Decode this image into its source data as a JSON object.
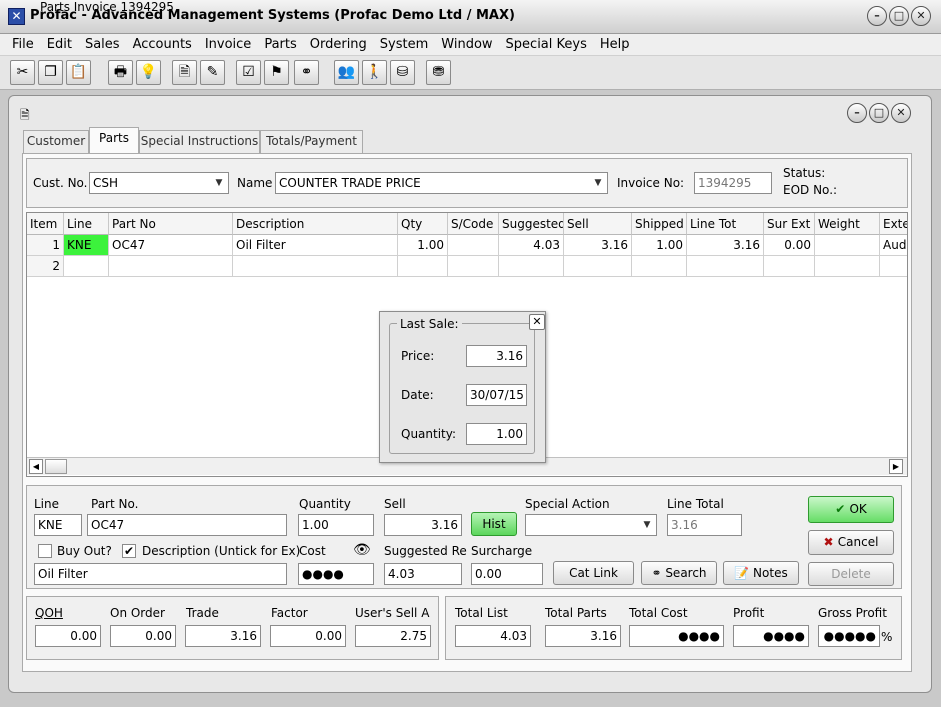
{
  "app_title": "Profac - Advanced Management Systems (Profac Demo Ltd / MAX)",
  "menu": [
    "File",
    "Edit",
    "Sales",
    "Accounts",
    "Invoice",
    "Parts",
    "Ordering",
    "System",
    "Window",
    "Special Keys",
    "Help"
  ],
  "window_title": "Parts Invoice 1394295",
  "tabs": [
    "Customer",
    "Parts",
    "Special Instructions",
    "Totals/Payment"
  ],
  "header": {
    "cust_no_label": "Cust. No.",
    "cust_no": "CSH",
    "name_label": "Name",
    "name": "COUNTER TRADE PRICE",
    "invoice_no_label": "Invoice No:",
    "invoice_no": "1394295",
    "status_label": "Status:",
    "eod_label": "EOD No.:"
  },
  "grid": {
    "columns": [
      "Item",
      "Line",
      "Part No",
      "Description",
      "Qty",
      "S/Code",
      "Suggested",
      "Sell",
      "Shipped",
      "Line Tot",
      "Sur Ext",
      "Weight",
      "Exte"
    ],
    "rows": [
      [
        "1",
        "KNE",
        "OC47",
        "Oil Filter",
        "1.00",
        "",
        "4.03",
        "3.16",
        "1.00",
        "3.16",
        "0.00",
        "",
        "Aud"
      ],
      [
        "2",
        "",
        "",
        "",
        "",
        "",
        "",
        "",
        "",
        "",
        "",
        "",
        ""
      ]
    ]
  },
  "last_sale": {
    "title": "Last Sale:",
    "price_label": "Price:",
    "price": "3.16",
    "date_label": "Date:",
    "date": "30/07/15",
    "quantity_label": "Quantity:",
    "quantity": "1.00"
  },
  "edit": {
    "line_label": "Line",
    "line": "KNE",
    "part_no_label": "Part No.",
    "part_no": "OC47",
    "quantity_label": "Quantity",
    "quantity": "1.00",
    "sell_label": "Sell",
    "sell": "3.16",
    "hist_label": "Hist",
    "special_action_label": "Special Action",
    "line_total_label": "Line Total",
    "line_total": "3.16",
    "buy_out_label": "Buy Out?",
    "description_chk_label": "Description (Untick for Ex)",
    "cost_label": "Cost",
    "cost": "●●●●",
    "suggested_label": "Suggested Re",
    "suggested": "4.03",
    "surcharge_label": "Surcharge",
    "surcharge": "0.00",
    "description": "Oil Filter",
    "cat_link_label": "Cat Link",
    "search_label": "Search",
    "notes_label": "Notes"
  },
  "buttons": {
    "ok": "OK",
    "cancel": "Cancel",
    "delete": "Delete"
  },
  "stock": {
    "qoh_label": "QOH",
    "qoh": "0.00",
    "on_order_label": "On Order",
    "on_order": "0.00",
    "trade_label": "Trade",
    "trade": "3.16",
    "factor_label": "Factor",
    "factor": "0.00",
    "users_sell_label": "User's Sell A",
    "users_sell": "2.75"
  },
  "totals": {
    "total_list_label": "Total List",
    "total_list": "4.03",
    "total_parts_label": "Total Parts",
    "total_parts": "3.16",
    "total_cost_label": "Total Cost",
    "total_cost": "●●●●",
    "profit_label": "Profit",
    "profit": "●●●●",
    "gross_profit_label": "Gross Profit",
    "gross_profit": "●●●●●",
    "percent": "%"
  }
}
